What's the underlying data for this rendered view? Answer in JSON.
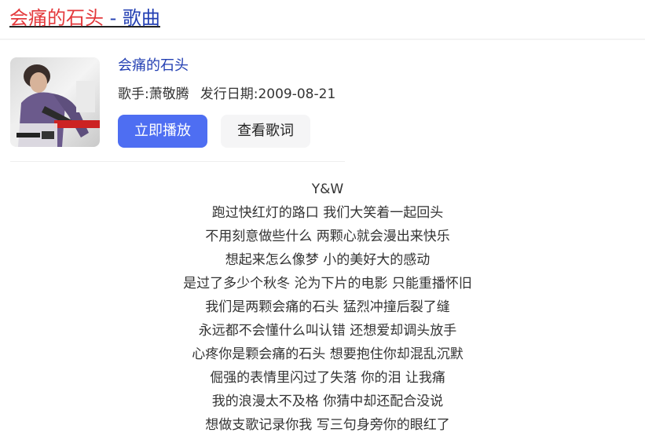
{
  "header": {
    "title_song": "会痛的石头",
    "title_suffix": " - 歌曲"
  },
  "card": {
    "cover_icon": "album-cover-image",
    "song_name": "会痛的石头",
    "singer_label": "歌手:",
    "singer": "萧敬腾",
    "release_label": "发行日期:",
    "release_date": "2009-08-21",
    "play_button": "立即播放",
    "lyrics_button": "查看歌词"
  },
  "lyrics": [
    "Y&W",
    "跑过快红灯的路口 我们大笑着一起回头",
    "不用刻意做些什么 两颗心就会漫出来快乐",
    "想起来怎么像梦 小的美好大的感动",
    "是过了多少个秋冬 沦为下片的电影 只能重播怀旧",
    "我们是两颗会痛的石头 猛烈冲撞后裂了缝",
    "永远都不会懂什么叫认错 还想爱却调头放手",
    "心疼你是颗会痛的石头 想要抱住你却混乱沉默",
    "倔强的表情里闪过了失落 你的泪 让我痛",
    "我的浪漫太不及格 你猜中却还配合没说",
    "想做支歌记录你我 写三句身旁你的眼红了"
  ],
  "colors": {
    "link_red": "#e4393c",
    "link_blue": "#2440b3",
    "primary_button": "#4e6ef2",
    "secondary_button": "#f5f5f6"
  }
}
